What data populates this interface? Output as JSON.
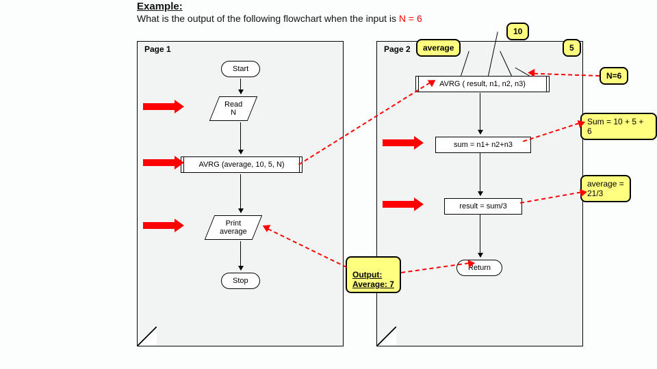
{
  "heading": "Example:",
  "question_prefix": "What is the output of the following flowchart when the input is  ",
  "question_input": "N = 6",
  "page1": {
    "label": "Page 1",
    "start": "Start",
    "read": "Read\nN",
    "call_sub": "AVRG (average, 10, 5, N)",
    "print": "Print\naverage",
    "stop": "Stop"
  },
  "page2": {
    "label": "Page 2",
    "header": "AVRG ( result, n1, n2, n3)",
    "sum": "sum =  n1+ n2+n3",
    "result": "result = sum/3",
    "return": "Return"
  },
  "callouts": {
    "average": "average",
    "v10": "10",
    "v5": "5",
    "n6": "N=6",
    "sum_eq": "Sum = 10 + 5 + 6",
    "avg_eq": "average =\n21/3",
    "output": "Output:\nAverage: 7"
  }
}
